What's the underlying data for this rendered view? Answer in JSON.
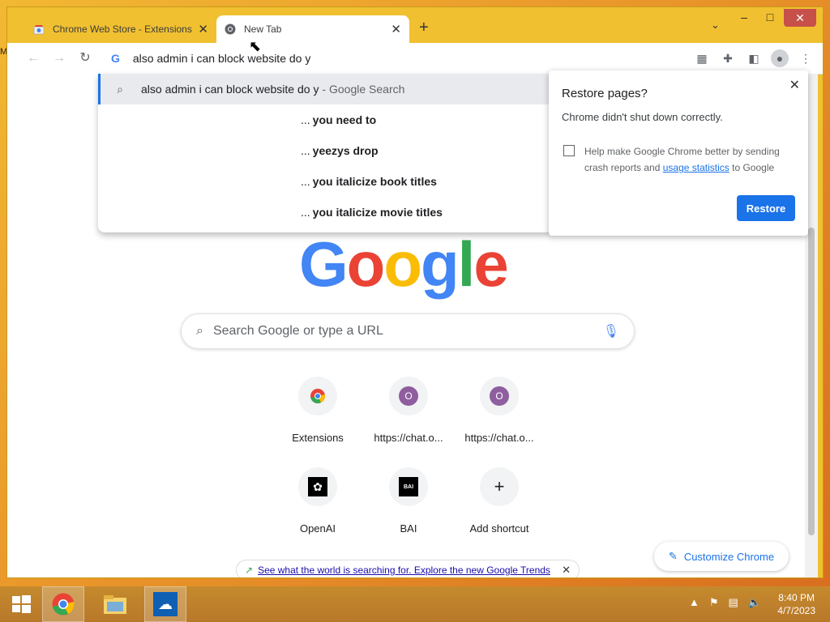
{
  "tabs": [
    {
      "title": "Chrome Web Store - Extensions",
      "active": false
    },
    {
      "title": "New Tab",
      "active": true
    }
  ],
  "omnibox": {
    "value": "also admin i can block website do y"
  },
  "dropdown": {
    "first": {
      "query": "also admin i can block website do y",
      "suffix": "- Google Search"
    },
    "suggestions": [
      {
        "prefix": "...",
        "bold": "you need to"
      },
      {
        "prefix": "...",
        "bold": "yeezys drop"
      },
      {
        "prefix": "...",
        "bold": "you italicize book titles"
      },
      {
        "prefix": "...",
        "bold": "you italicize movie titles"
      }
    ]
  },
  "newtab": {
    "logo": {
      "letters": [
        "G",
        "o",
        "o",
        "g",
        "l",
        "e"
      ],
      "colors": [
        "#4285f4",
        "#ea4335",
        "#fbbc05",
        "#4285f4",
        "#34a853",
        "#ea4335"
      ]
    },
    "search_placeholder": "Search Google or type a URL",
    "shortcuts": [
      {
        "label": "Extensions",
        "icon": "chrome-icon"
      },
      {
        "label": "https://chat.o...",
        "icon": "letter-o-icon",
        "letter": "O"
      },
      {
        "label": "https://chat.o...",
        "icon": "letter-o-icon",
        "letter": "O"
      },
      {
        "label": "OpenAI",
        "icon": "openai-icon"
      },
      {
        "label": "BAI",
        "icon": "bai-icon",
        "letter": "BAI"
      },
      {
        "label": "Add shortcut",
        "icon": "plus-icon",
        "letter": "+"
      }
    ],
    "trends_text": "See what the world is searching for. Explore the new Google Trends",
    "customize_label": "Customize Chrome"
  },
  "restore_dialog": {
    "title": "Restore pages?",
    "message": "Chrome didn't shut down correctly.",
    "checkbox_text_before": "Help make Google Chrome better by sending crash reports and",
    "checkbox_link": "usage statistics",
    "checkbox_text_after": "to Google",
    "button": "Restore"
  },
  "taskbar": {
    "time": "8:40 PM",
    "date": "4/7/2023"
  },
  "colors": {
    "accent": "#1a73e8",
    "taskbar": "#c58a2d",
    "window_frame": "#f0c030"
  }
}
